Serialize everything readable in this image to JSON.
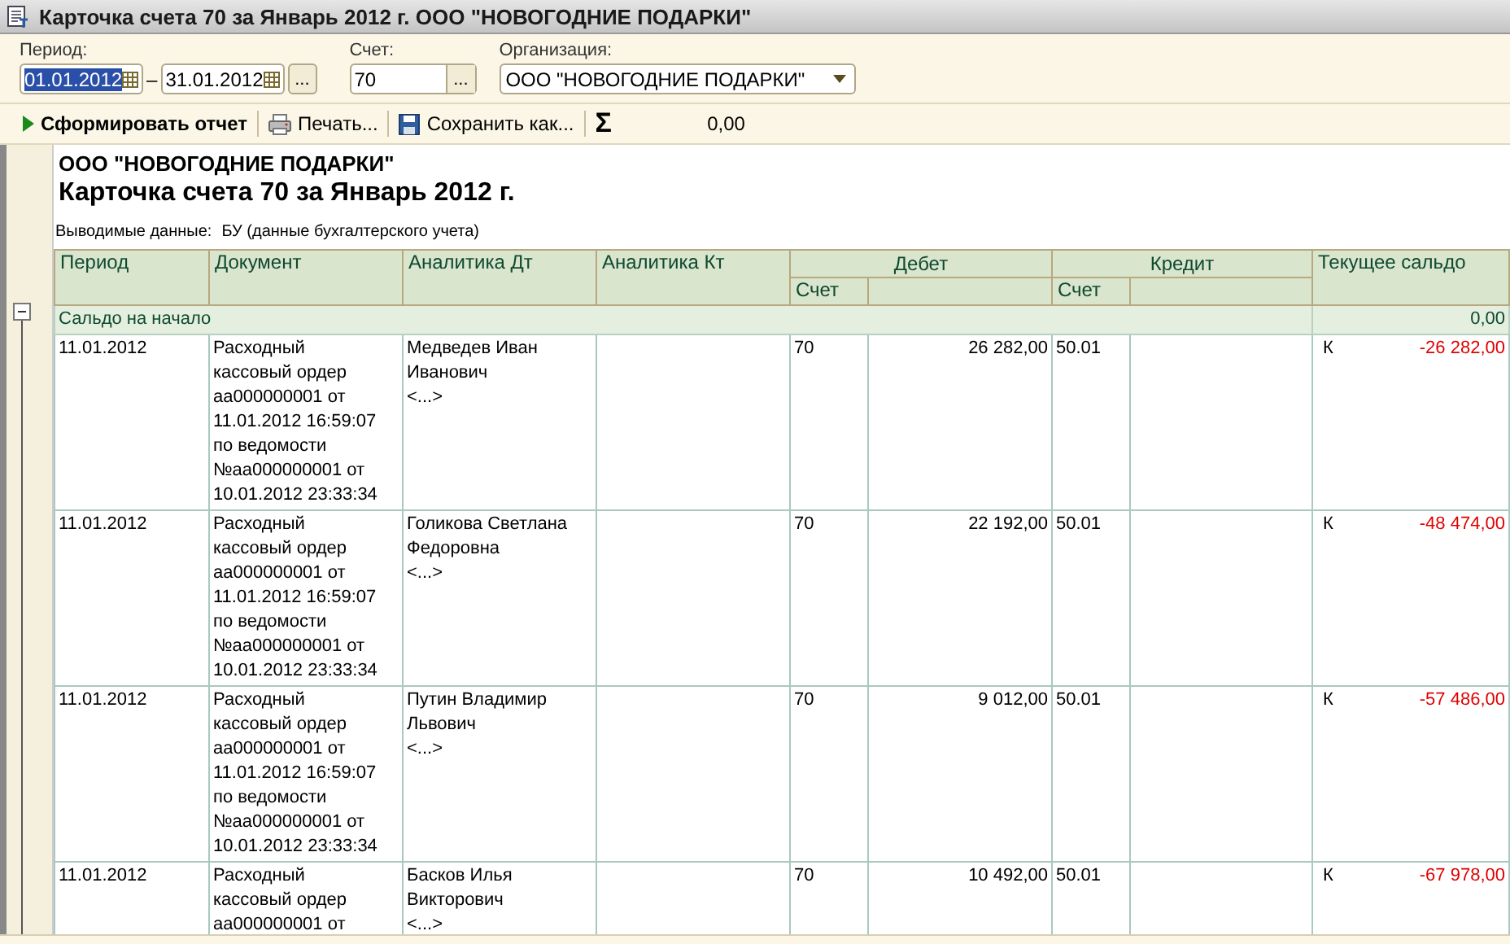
{
  "window": {
    "title": "Карточка счета 70 за Январь 2012 г. ООО \"НОВОГОДНИЕ ПОДАРКИ\""
  },
  "filters": {
    "period_label": "Период:",
    "date_from": "01.01.2012",
    "date_from_selected": true,
    "separator": "–",
    "date_to": "31.01.2012",
    "period_button": "...",
    "account_label": "Счет:",
    "account": "70",
    "account_button": "...",
    "org_label": "Организация:",
    "org": "ООО \"НОВОГОДНИЕ ПОДАРКИ\""
  },
  "toolbar": {
    "generate": "Сформировать отчет",
    "print": "Печать...",
    "save": "Сохранить как...",
    "sum_sign": "Σ",
    "sum": "0,00"
  },
  "report": {
    "org": "ООО \"НОВОГОДНИЕ ПОДАРКИ\"",
    "title": "Карточка счета 70 за Январь 2012 г.",
    "data_label": "Выводимые данные:",
    "data_value": "БУ (данные бухгалтерского учета)",
    "columns": [
      "Период",
      "Документ",
      "Аналитика Дт",
      "Аналитика Кт"
    ],
    "debit": "Дебет",
    "credit": "Кредит",
    "balance": "Текущее сальдо",
    "debit_sub_account": "Счет",
    "credit_sub_account": "Счет",
    "opening": {
      "label": "Сальдо на начало",
      "value": "0,00",
      "expanded": true
    },
    "rows": [
      {
        "period": "11.01.2012",
        "document": "Расходный\nкассовый ордер\nаа000000001 от\n11.01.2012 16:59:07\n по ведомости\n№аа000000001 от\n10.01.2012 23:33:34",
        "analytics_dt": "Медведев Иван\nИванович\n<...>",
        "debit_account": "70",
        "debit_amount": "26 282,00",
        "credit_account": "50.01",
        "side": "К",
        "balance": "-26 282,00"
      },
      {
        "period": "11.01.2012",
        "document": "Расходный\nкассовый ордер\nаа000000001 от\n11.01.2012 16:59:07\n по ведомости\n№аа000000001 от\n10.01.2012 23:33:34",
        "analytics_dt": "Голикова Светлана\nФедоровна\n<...>",
        "debit_account": "70",
        "debit_amount": "22 192,00",
        "credit_account": "50.01",
        "side": "К",
        "balance": "-48 474,00"
      },
      {
        "period": "11.01.2012",
        "document": "Расходный\nкассовый ордер\nаа000000001 от\n11.01.2012 16:59:07\n по ведомости\n№аа000000001 от\n10.01.2012 23:33:34",
        "analytics_dt": "Путин Владимир\nЛьвович\n<...>",
        "debit_account": "70",
        "debit_amount": "9 012,00",
        "credit_account": "50.01",
        "side": "К",
        "balance": "-57 486,00"
      },
      {
        "period": "11.01.2012",
        "document": "Расходный\nкассовый ордер\nаа000000001 от",
        "analytics_dt": "Басков Илья\nВикторович\n<...>",
        "debit_account": "70",
        "debit_amount": "10 492,00",
        "credit_account": "50.01",
        "side": "К",
        "balance": "-67 978,00"
      }
    ]
  }
}
